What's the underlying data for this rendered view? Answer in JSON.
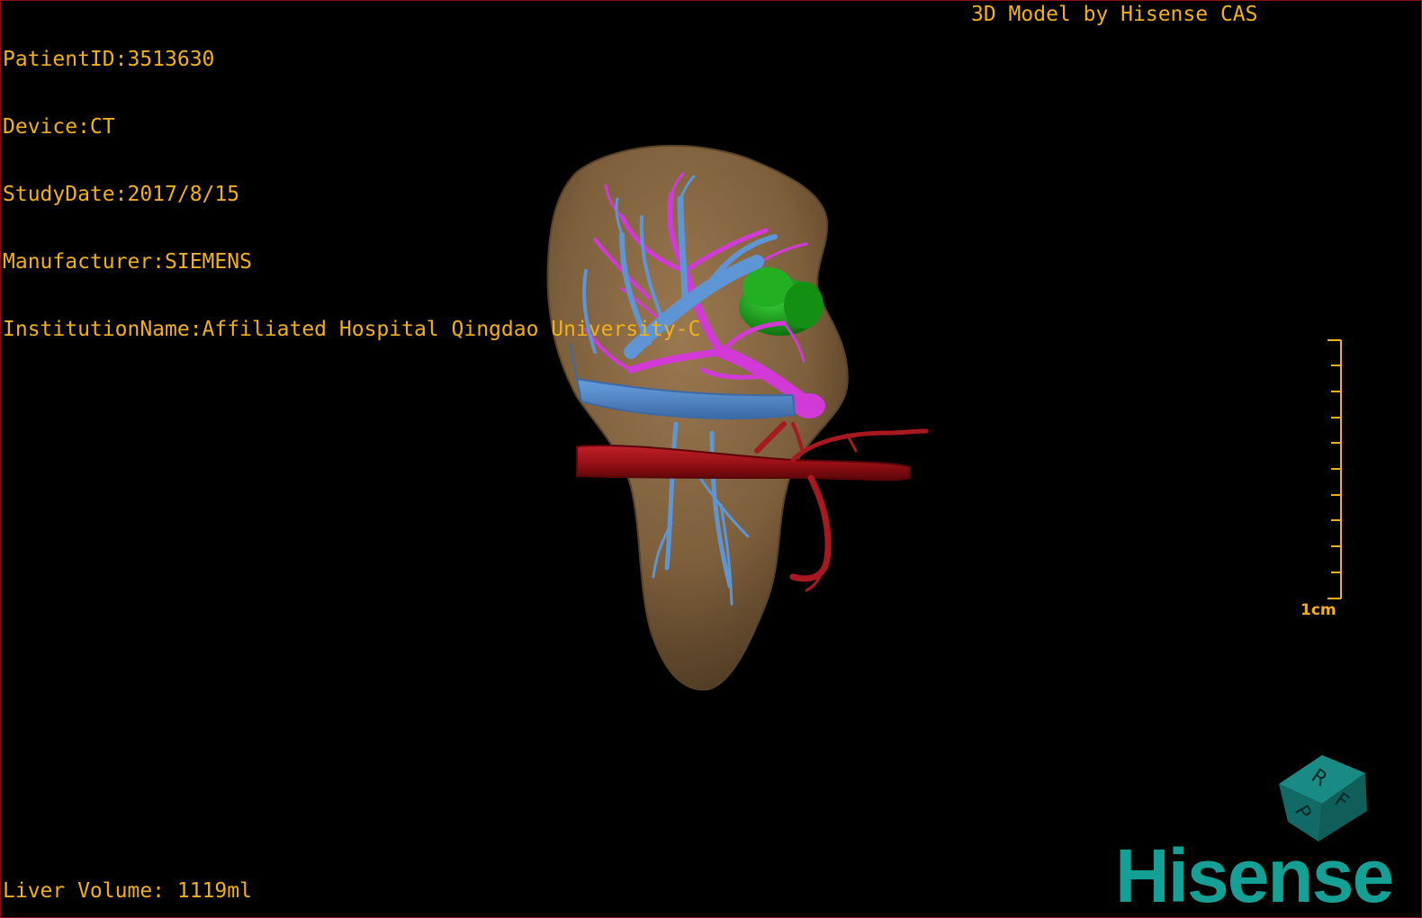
{
  "overlay": {
    "patient_id": "PatientID:3513630",
    "device": "Device:CT",
    "study_date": "StudyDate:2017/8/15",
    "manufacturer": "Manufacturer:SIEMENS",
    "institution": "InstitutionName:Affiliated Hospital Qingdao University-C",
    "brand_caption": "3D Model by Hisense CAS",
    "liver_volume": "Liver Volume: 1119ml"
  },
  "scale_bar": {
    "label": "1cm"
  },
  "orientation_cube": {
    "faces": [
      "R",
      "F",
      "P"
    ]
  },
  "logo": {
    "text": "Hisense"
  },
  "colors": {
    "overlay_text": "#f0b01a",
    "liver": "#7d5f3c",
    "portal_vein": "#5e95d4",
    "hepatic_vein": "#d23ad8",
    "artery": "#9a1016",
    "tumor": "#1aa01a",
    "logo": "#14a095",
    "border": "#8a1010"
  },
  "scene_structures": [
    "liver",
    "portal-vein",
    "hepatic-vein",
    "artery",
    "tumor"
  ]
}
